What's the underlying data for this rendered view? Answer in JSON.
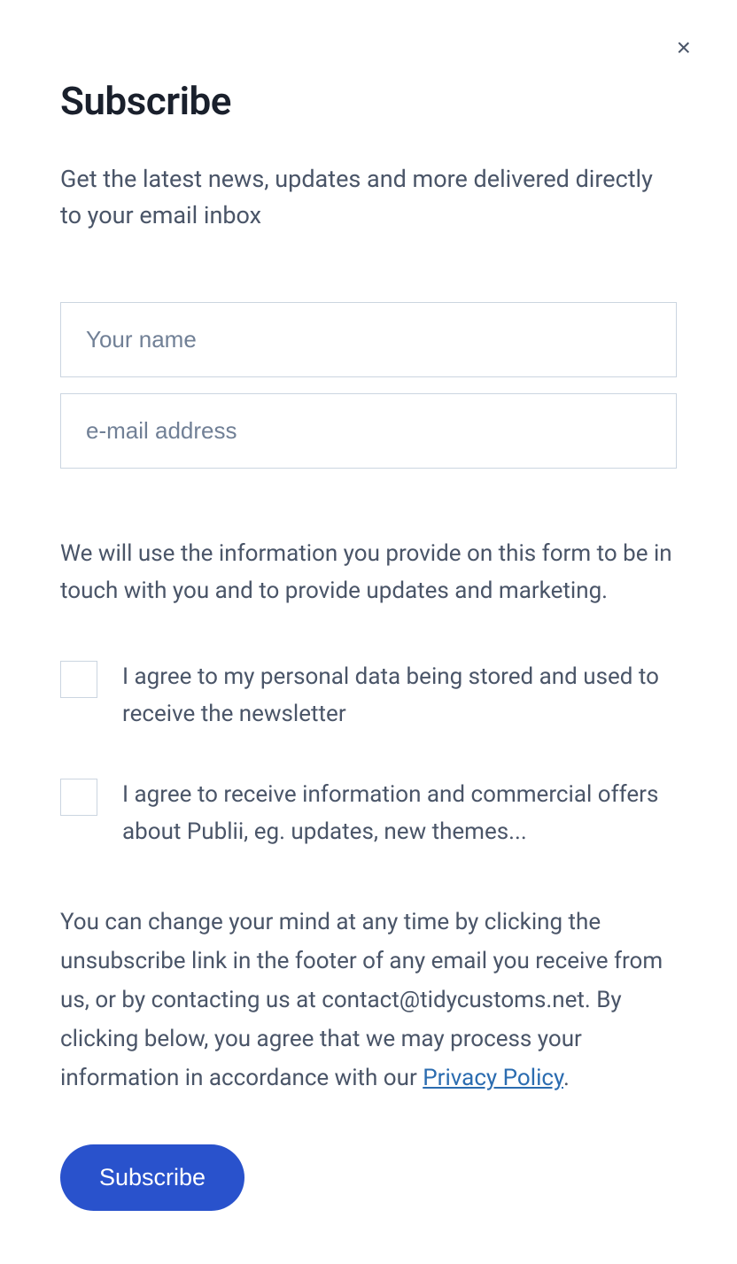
{
  "close_label": "×",
  "title": "Subscribe",
  "subtitle": "Get the latest news, updates and more delivered directly to your email inbox",
  "inputs": {
    "name_placeholder": "Your name",
    "email_placeholder": "e-mail address"
  },
  "info_text": "We will use the information you provide on this form to be in touch with you and to provide updates and marketing.",
  "checkboxes": {
    "agree_data": "I agree to my personal data being stored and used to receive the newsletter",
    "agree_commercial": "I agree to receive information and commercial offers about Publii, eg. updates, new themes..."
  },
  "footer_text_before": "You can change your mind at any time by clicking the unsubscribe link in the footer of any email you receive from us, or by contacting us at contact@tidycustoms.net. By clicking below, you agree that we may process your information in accordance with our ",
  "privacy_link_text": "Privacy Policy",
  "footer_text_after": ".",
  "submit_label": "Subscribe"
}
